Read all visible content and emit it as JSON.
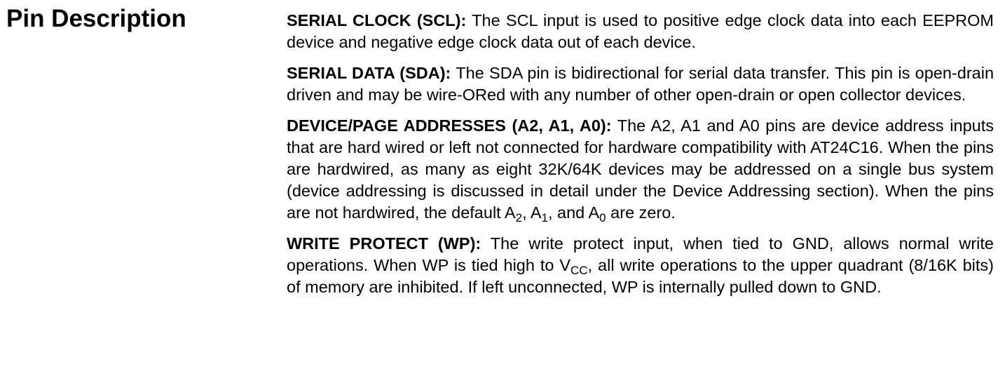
{
  "section": {
    "title": "Pin Description"
  },
  "pins": [
    {
      "name": "SERIAL CLOCK (SCL):",
      "text": "The SCL input is used to positive edge clock data into each EEPROM device and negative edge clock data out of each device."
    },
    {
      "name": "SERIAL DATA (SDA):",
      "text": "The SDA pin is bidirectional for serial data transfer. This pin is open-drain driven and may be wire-ORed with any number of other open-drain or open collector devices."
    },
    {
      "name": "DEVICE/PAGE ADDRESSES (A2, A1, A0):",
      "text_1": "The A2, A1 and A0 pins are device address inputs that are hard wired or left not connected for hardware compatibility with AT24C16. When the pins are hardwired, as many as eight 32K/64K devices may be addressed on a single bus system (device addressing is discussed in detail under the Device Addressing section). When the pins are not hardwired, the default A",
      "sub_1": "2",
      "text_2": ", A",
      "sub_2": "1",
      "text_3": ", and A",
      "sub_3": "0",
      "text_4": " are zero."
    },
    {
      "name": "WRITE PROTECT (WP):",
      "text_1": "The write protect input, when tied to GND, allows normal write operations. When WP is tied high to V",
      "sub_1": "CC",
      "text_2": ", all write operations to the upper quadrant (8/16K bits) of memory are inhibited. If left unconnected, WP is internally pulled down to GND."
    }
  ]
}
